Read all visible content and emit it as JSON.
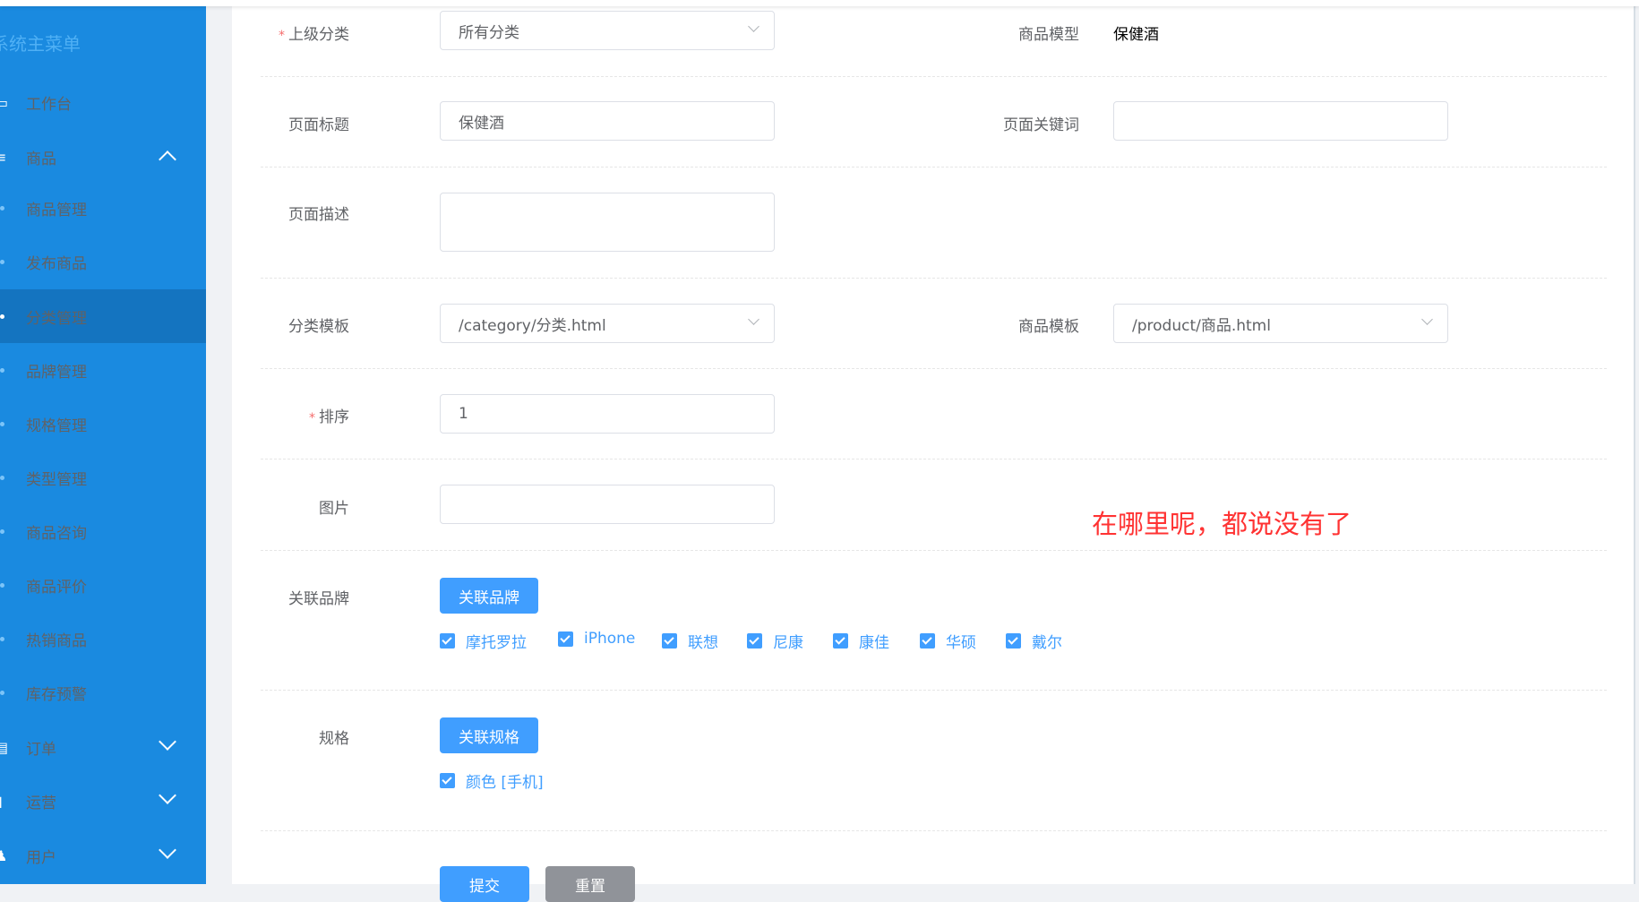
{
  "sidebar": {
    "title": "系统主菜单",
    "items": [
      {
        "label": "工作台",
        "type": "top",
        "icon": "dashboard-icon"
      },
      {
        "label": "商品",
        "type": "group",
        "expanded": true,
        "icon": "list-icon"
      },
      {
        "label": "商品管理",
        "type": "sub"
      },
      {
        "label": "发布商品",
        "type": "sub"
      },
      {
        "label": "分类管理",
        "type": "sub",
        "active": true
      },
      {
        "label": "品牌管理",
        "type": "sub"
      },
      {
        "label": "规格管理",
        "type": "sub"
      },
      {
        "label": "类型管理",
        "type": "sub"
      },
      {
        "label": "商品咨询",
        "type": "sub"
      },
      {
        "label": "商品评价",
        "type": "sub"
      },
      {
        "label": "热销商品",
        "type": "sub"
      },
      {
        "label": "库存预警",
        "type": "sub"
      },
      {
        "label": "订单",
        "type": "group",
        "expanded": false,
        "icon": "order-icon"
      },
      {
        "label": "运营",
        "type": "group",
        "expanded": false,
        "icon": "chart-icon"
      },
      {
        "label": "用户",
        "type": "group",
        "expanded": false,
        "icon": "user-icon"
      }
    ]
  },
  "form": {
    "parent_category": {
      "label": "上级分类",
      "required": "*",
      "value": "所有分类"
    },
    "product_model": {
      "label": "商品模型",
      "value": "保健酒"
    },
    "page_title": {
      "label": "页面标题",
      "value": "保健酒"
    },
    "page_keywords": {
      "label": "页面关键词",
      "value": ""
    },
    "page_description": {
      "label": "页面描述",
      "value": ""
    },
    "category_template": {
      "label": "分类模板",
      "value": "/category/分类.html"
    },
    "product_template": {
      "label": "商品模板",
      "value": "/product/商品.html"
    },
    "sort": {
      "label": "排序",
      "required": "*",
      "value": "1"
    },
    "image": {
      "label": "图片",
      "value": ""
    },
    "brands": {
      "label": "关联品牌",
      "button": "关联品牌",
      "items": [
        "摩托罗拉",
        "iPhone",
        "联想",
        "尼康",
        "康佳",
        "华硕",
        "戴尔"
      ]
    },
    "specs": {
      "label": "规格",
      "button": "关联规格",
      "items": [
        "颜色 [手机]"
      ]
    },
    "submit": "提交",
    "reset": "重置"
  },
  "annotation": "在哪里呢，都说没有了",
  "colors": {
    "sidebar": "#1a8ae0",
    "sidebar_active": "#1474c0",
    "primary": "#409eff",
    "annotation": "#ff3333"
  }
}
